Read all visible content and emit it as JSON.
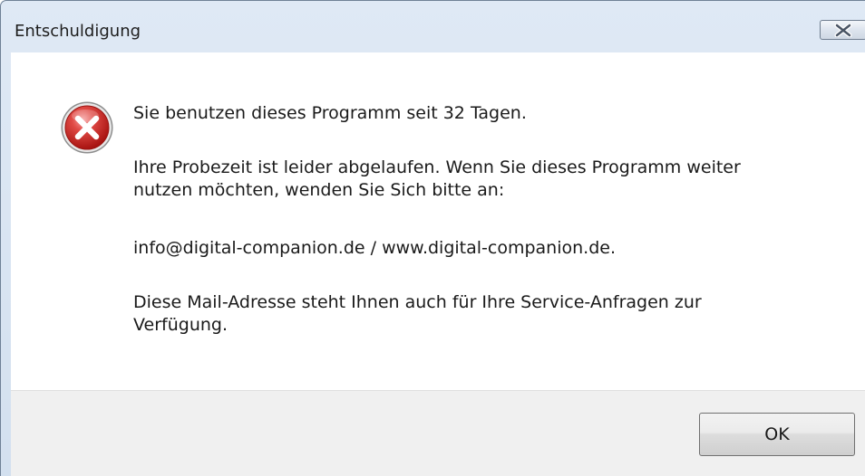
{
  "window": {
    "title": "Entschuldigung"
  },
  "titlebar": {
    "close_icon": "close-icon"
  },
  "dialog": {
    "icon": "error-icon",
    "lines": [
      "Sie benutzen dieses Programm seit 32 Tagen.",
      "Ihre Probezeit ist leider abgelaufen. Wenn Sie dieses Programm weiter\nnutzen möchten, wenden Sie Sich bitte an:",
      "info@digital-companion.de / www.digital-companion.de.",
      "Diese Mail-Adresse steht Ihnen auch für Ihre Service-Anfragen zur\nVerfügung."
    ]
  },
  "buttons": {
    "ok_label": "OK"
  },
  "colors": {
    "title_bar": "#dfe9f5",
    "error_red": "#c9211e",
    "content_bg": "#ffffff",
    "footer_bg": "#f0f0f0"
  }
}
